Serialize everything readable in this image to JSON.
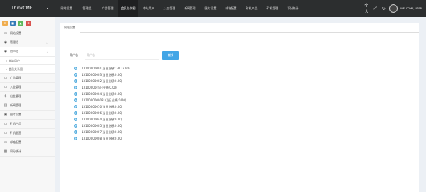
{
  "app": {
    "brand": "ThinkCMF",
    "collapse_icon": "chevron-left-icon"
  },
  "nav": {
    "tabs": [
      {
        "label": "网站设置",
        "active": false
      },
      {
        "label": "管理组",
        "active": false
      },
      {
        "label": "广告管理",
        "active": false
      },
      {
        "label": "会员总体图",
        "active": true
      },
      {
        "label": "本站用户",
        "active": false
      },
      {
        "label": "入金管理",
        "active": false
      },
      {
        "label": "新闻管理",
        "active": false
      },
      {
        "label": "图片设置",
        "active": false
      },
      {
        "label": "邮箱配置",
        "active": false
      },
      {
        "label": "矿机产品",
        "active": false
      },
      {
        "label": "矿机管理",
        "active": false
      },
      {
        "label": "积分统计",
        "active": false
      }
    ],
    "expand_label": "个人",
    "welcome": "WELCOME, USER"
  },
  "quick_buttons": [
    "✚",
    "■",
    "▲",
    "✖"
  ],
  "sidebar": {
    "items": [
      {
        "label": "网站设置",
        "icon": "monitor-icon",
        "glyph": "▭",
        "arrow": ""
      },
      {
        "label": "管理组",
        "icon": "user-icon",
        "glyph": "◉",
        "arrow": "›"
      },
      {
        "label": "用户组",
        "icon": "user-icon",
        "glyph": "◉",
        "arrow": "‹",
        "open": true,
        "children": [
          "本站用户",
          "会员关系图"
        ]
      },
      {
        "label": "广告管理",
        "icon": "monitor-icon",
        "glyph": "▭",
        "arrow": ""
      },
      {
        "label": "入金管理",
        "icon": "monitor-icon",
        "glyph": "▭",
        "arrow": ""
      },
      {
        "label": "出金管理",
        "icon": "dollar-icon",
        "glyph": "$",
        "arrow": ""
      },
      {
        "label": "新闻管理",
        "icon": "news-icon",
        "glyph": "▤",
        "arrow": ""
      },
      {
        "label": "图片设置",
        "icon": "image-icon",
        "glyph": "▣",
        "arrow": ""
      },
      {
        "label": "矿机产品",
        "icon": "monitor-icon",
        "glyph": "▭",
        "arrow": ""
      },
      {
        "label": "矿机配置",
        "icon": "monitor-icon",
        "glyph": "▭",
        "arrow": ""
      },
      {
        "label": "邮箱配置",
        "icon": "monitor-icon",
        "glyph": "▭",
        "arrow": ""
      },
      {
        "label": "积分统计",
        "icon": "stats-icon",
        "glyph": "▦",
        "arrow": ""
      }
    ]
  },
  "content": {
    "tab": "网站设置",
    "search": {
      "label": "用户名",
      "placeholder": "用户名",
      "button": "查找"
    },
    "tree": [
      "13100000001(当日业绩:13113.00)",
      "13100000003(当日业绩:0.00)",
      "13100000002(当日业绩:0.00)",
      "13100000(当日业绩:0.00)",
      "13100000004(当日业绩:0.00)",
      "1310000000081(当日业绩:0.00)",
      "13100000010(当日业绩:0.00)",
      "13100000006(当日业绩:0.00)",
      "13100000044(当日业绩:0.00)",
      "13100000005(当日业绩:0.00)",
      "13100000007(当日业绩:0.00)",
      "13100000008(当日业绩:0.00)"
    ]
  }
}
